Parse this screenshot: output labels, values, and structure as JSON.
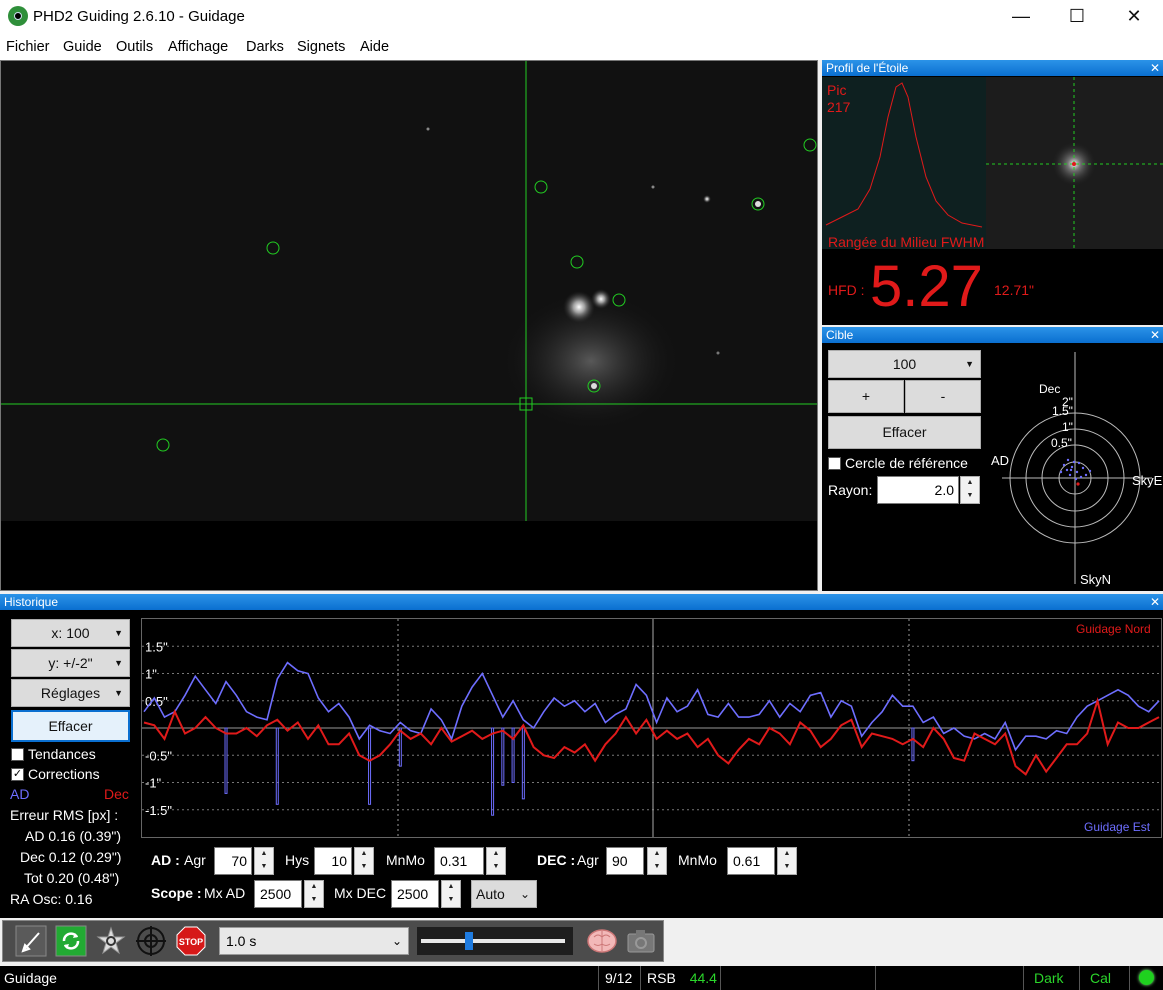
{
  "window": {
    "title": "PHD2 Guiding 2.6.10 - Guidage"
  },
  "menu": [
    "Fichier",
    "Guide",
    "Outils",
    "Affichage",
    "Darks",
    "Signets",
    "Aide"
  ],
  "profile": {
    "title": "Profil de l'Étoile",
    "peak_label": "Pic",
    "peak_value": "217",
    "mid_row_label": "Rangée du Milieu FWHM",
    "hfd_label": "HFD :",
    "hfd_value": "5.27",
    "hfd_arcsec": "12.71\""
  },
  "target": {
    "title": "Cible",
    "zoom_value": "100",
    "plus_label": "+",
    "minus_label": "-",
    "clear_label": "Effacer",
    "ref_circle_label": "Cercle de référence",
    "radius_label": "Rayon:",
    "radius_value": "2.0",
    "labels": {
      "dec": "Dec",
      "ad": "AD",
      "skye": "SkyE",
      "skyn": "SkyN"
    },
    "rings": [
      "2\"",
      "1.5\"",
      "1\"",
      "0.5\""
    ]
  },
  "history": {
    "title": "Historique",
    "x_scale": "x: 100",
    "y_scale": "y: +/-2\"",
    "settings_label": "Réglages",
    "clear_label": "Effacer",
    "trends_label": "Tendances",
    "trends_checked": false,
    "corrections_label": "Corrections",
    "corrections_checked": true,
    "ra_label": "AD",
    "dec_label": "Dec",
    "rms_title": "Erreur RMS [px] :",
    "rms_ra": "AD 0.16 (0.39\")",
    "rms_dec": "Dec 0.12 (0.29\")",
    "rms_tot": "Tot 0.20 (0.48\")",
    "ra_osc": "RA Osc: 0.16",
    "legend_north": "Guidage Nord",
    "legend_east": "Guidage Est",
    "y_ticks": [
      "1.5\"",
      "1\"",
      "0.5\"",
      "-0.5\"",
      "-1\"",
      "-1.5\""
    ]
  },
  "controls": {
    "ra_bold": "AD :",
    "agr_label": "Agr",
    "ra_agr": "70",
    "hys_label": "Hys",
    "ra_hys": "10",
    "mnmo_label": "MnMo",
    "ra_mnmo": "0.31",
    "dec_bold": "DEC :",
    "dec_agr_label": "Agr",
    "dec_agr": "90",
    "dec_mnmo_label": "MnMo",
    "dec_mnmo": "0.61",
    "scope_bold": "Scope :",
    "mx_ad_label": "Mx AD",
    "mx_ad": "2500",
    "mx_dec_label": "Mx DEC",
    "mx_dec": "2500",
    "dec_mode": "Auto"
  },
  "toolbar": {
    "exposure": "1.0 s",
    "gamma_level": 0.33
  },
  "status": {
    "state": "Guidage",
    "frames": "9/12",
    "snr_label": "RSB",
    "snr_value": "44.4",
    "dark": "Dark",
    "cal": "Cal"
  },
  "colors": {
    "ra": "#6e6eff",
    "dec": "#e01a1a",
    "reticle": "#22cc22",
    "accent": "#0a6fd0"
  },
  "chart_data": {
    "type": "line",
    "title": "",
    "ylim": [
      -2,
      2
    ],
    "series": [
      {
        "name": "AD",
        "values": [
          0.3,
          0.55,
          0.2,
          0.3,
          0.6,
          0.95,
          0.7,
          0.45,
          0.85,
          0.6,
          0.3,
          0.2,
          0.15,
          0.9,
          1.2,
          1.05,
          1.0,
          0.55,
          0.3,
          0.45,
          0.2,
          -0.2,
          0.05,
          -0.05,
          -0.1,
          0.1,
          -0.05,
          -0.1,
          0.35,
          0.15,
          -0.2,
          0.4,
          0.75,
          1.0,
          0.6,
          0.2,
          0.5,
          0.15,
          0.0,
          0.3,
          0.55,
          0.4,
          0.5,
          0.3,
          0.45,
          0.1,
          0.25,
          0.35,
          0.8,
          0.6,
          0.1,
          0.55,
          0.3,
          0.4,
          0.7,
          0.25,
          0.2,
          0.45,
          0.2,
          0.2,
          0.25,
          0.5,
          0.2,
          0.45,
          0.3,
          0.6,
          0.65,
          0.2,
          0.5,
          0.4,
          -0.15,
          0.1,
          0.3,
          0.6,
          0.4,
          0.4,
          0.1,
          0.2,
          -0.1,
          0.0,
          -0.15,
          -0.2,
          -0.1,
          -0.2,
          0.1,
          -0.4,
          -0.15,
          -0.15,
          -0.2,
          -0.05,
          -0.1,
          0.2,
          0.4,
          0.5,
          0.6,
          0.7,
          0.6,
          0.4,
          0.3,
          0.5
        ]
      },
      {
        "name": "Dec",
        "values": [
          0.1,
          0.05,
          -0.2,
          0.3,
          -0.1,
          0.0,
          0.2,
          0.0,
          -0.1,
          -0.1,
          0.0,
          -0.15,
          0.05,
          0.15,
          -0.05,
          0.1,
          -0.2,
          0.05,
          -0.3,
          -0.3,
          -0.1,
          -0.5,
          -0.6,
          -0.5,
          -0.3,
          -0.05,
          -0.2,
          -0.1,
          -0.3,
          0.0,
          -0.25,
          -0.15,
          -0.05,
          -0.2,
          -0.1,
          -0.05,
          -0.2,
          0.05,
          -0.35,
          -0.5,
          -0.55,
          -0.35,
          -0.45,
          -0.3,
          -0.6,
          -0.3,
          -0.1,
          0.2,
          -0.1,
          0.15,
          -0.2,
          -0.05,
          -0.2,
          -0.1,
          -0.35,
          -0.2,
          -0.5,
          -0.65,
          -0.4,
          -0.2,
          -0.3,
          0.0,
          -0.1,
          -0.3,
          0.1,
          -0.05,
          -0.35,
          -0.2,
          0.05,
          0.15,
          -0.35,
          -0.1,
          -0.15,
          -0.2,
          -0.3,
          -0.2,
          -0.35,
          0.0,
          -0.2,
          -0.55,
          -0.6,
          -0.1,
          -0.2,
          -0.3,
          -0.1,
          -0.7,
          -0.85,
          -0.5,
          -0.8,
          -0.55,
          -0.3,
          -0.3,
          -0.1,
          0.5,
          -0.3,
          0.1,
          0.0,
          0.0,
          0.1,
          0.2
        ]
      }
    ]
  }
}
